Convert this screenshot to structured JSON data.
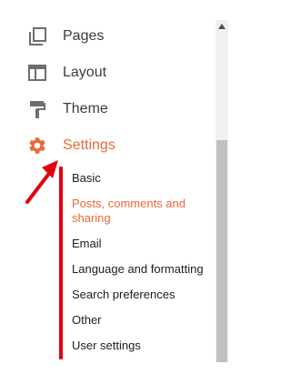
{
  "nav": {
    "pages": {
      "label": "Pages",
      "icon": "pages-icon"
    },
    "layout": {
      "label": "Layout",
      "icon": "layout-icon"
    },
    "theme": {
      "label": "Theme",
      "icon": "theme-icon"
    },
    "settings": {
      "label": "Settings",
      "icon": "gear-icon"
    }
  },
  "settings_submenu": {
    "items": [
      {
        "label": "Basic"
      },
      {
        "label": "Posts, comments and sharing"
      },
      {
        "label": "Email"
      },
      {
        "label": "Language and formatting"
      },
      {
        "label": "Search preferences"
      },
      {
        "label": "Other"
      },
      {
        "label": "User settings"
      }
    ]
  },
  "colors": {
    "accent": "#e8693a",
    "annotation_red": "#e3000f",
    "icon_gray": "#6e6e6e",
    "text": "#202020"
  }
}
